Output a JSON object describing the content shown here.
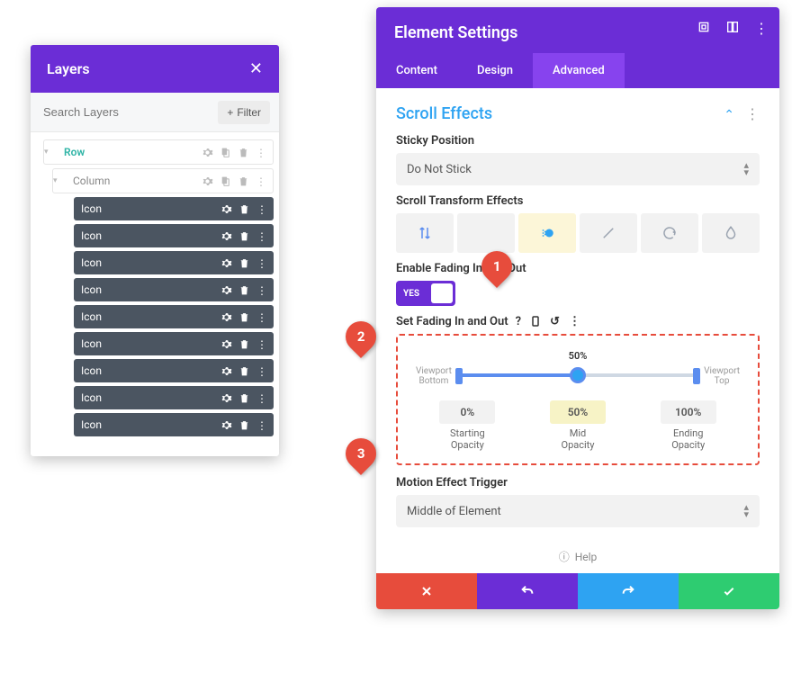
{
  "layers": {
    "title": "Layers",
    "search_placeholder": "Search Layers",
    "filter_label": "Filter",
    "row_label": "Row",
    "column_label": "Column",
    "icon_items": [
      "Icon",
      "Icon",
      "Icon",
      "Icon",
      "Icon",
      "Icon",
      "Icon",
      "Icon",
      "Icon"
    ]
  },
  "settings": {
    "title": "Element Settings",
    "tabs": {
      "content": "Content",
      "design": "Design",
      "advanced": "Advanced"
    },
    "section_title": "Scroll Effects",
    "sticky": {
      "label": "Sticky Position",
      "value": "Do Not Stick"
    },
    "transform_effects_label": "Scroll Transform Effects",
    "enable_fade_label": "Enable Fading In and Out",
    "toggle_text": "YES",
    "set_fade_label": "Set Fading In and Out",
    "track": {
      "top_value": "50%",
      "viewport_bottom": "Viewport\nBottom",
      "viewport_top": "Viewport\nTop"
    },
    "opacity": {
      "start_val": "0%",
      "start_lbl": "Starting\nOpacity",
      "mid_val": "50%",
      "mid_lbl": "Mid\nOpacity",
      "end_val": "100%",
      "end_lbl": "Ending\nOpacity"
    },
    "motion_trigger": {
      "label": "Motion Effect Trigger",
      "value": "Middle of Element"
    },
    "help": "Help"
  },
  "annotations": {
    "m1": "1",
    "m2": "2",
    "m3": "3"
  }
}
